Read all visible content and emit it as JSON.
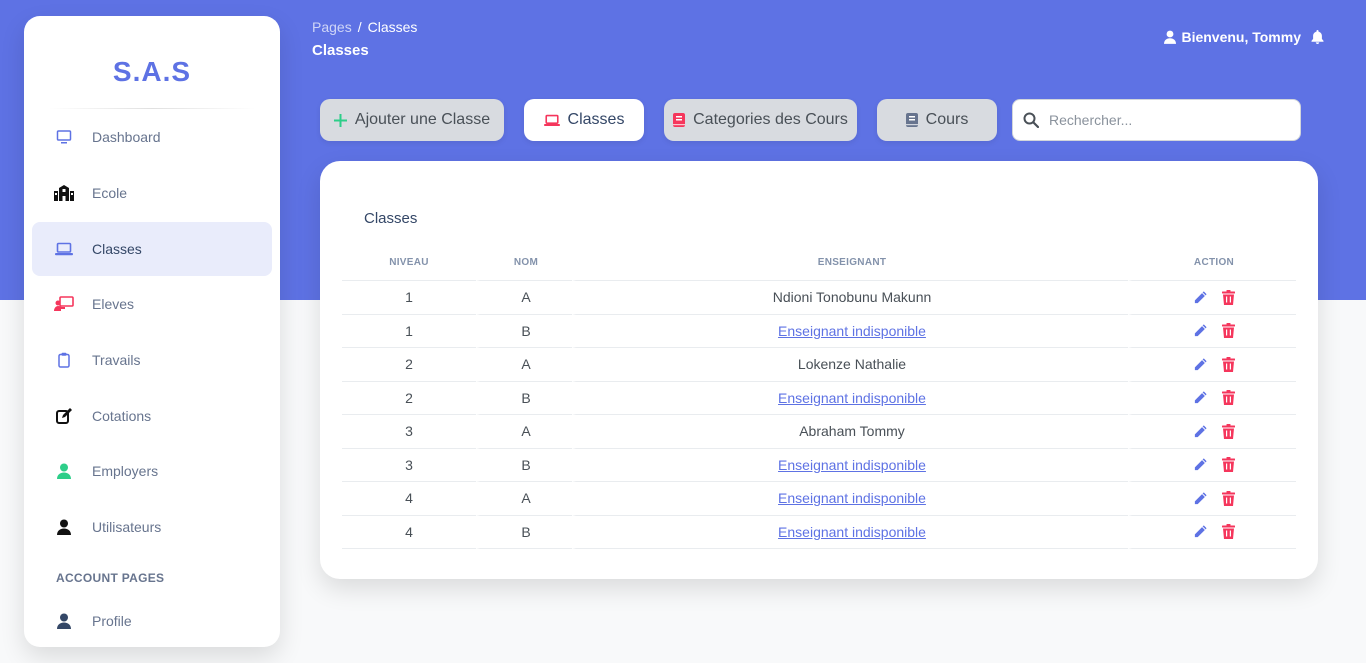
{
  "brand": "S.A.S",
  "sidebar": {
    "items": [
      {
        "label": "Dashboard",
        "icon": "monitor-icon"
      },
      {
        "label": "Ecole",
        "icon": "school-icon"
      },
      {
        "label": "Classes",
        "icon": "laptop-icon",
        "active": true
      },
      {
        "label": "Eleves",
        "icon": "chalkboard-teacher-icon"
      },
      {
        "label": "Travails",
        "icon": "clipboard-icon"
      },
      {
        "label": "Cotations",
        "icon": "edit-icon"
      },
      {
        "label": "Employers",
        "icon": "user-icon"
      },
      {
        "label": "Utilisateurs",
        "icon": "user-icon"
      }
    ],
    "section_title": "ACCOUNT PAGES",
    "account_items": [
      {
        "label": "Profile",
        "icon": "user-icon"
      }
    ]
  },
  "header": {
    "breadcrumb_root": "Pages",
    "breadcrumb_separator": "/",
    "breadcrumb_current": "Classes",
    "title": "Classes",
    "welcome": "Bienvenu, Tommy"
  },
  "toolbar": {
    "add_label": "Ajouter une Classe",
    "classes_label": "Classes",
    "categories_label": "Categories des Cours",
    "cours_label": "Cours",
    "search_placeholder": "Rechercher..."
  },
  "table": {
    "title": "Classes",
    "headers": {
      "niveau": "NIVEAU",
      "nom": "NOM",
      "enseignant": "ENSEIGNANT",
      "action": "ACTION"
    },
    "rows": [
      {
        "niveau": "1",
        "nom": "A",
        "enseignant": "Ndioni Tonobunu Makunn",
        "linked": false
      },
      {
        "niveau": "1",
        "nom": "B",
        "enseignant": "Enseignant indisponible",
        "linked": true
      },
      {
        "niveau": "2",
        "nom": "A",
        "enseignant": "Lokenze Nathalie",
        "linked": false
      },
      {
        "niveau": "2",
        "nom": "B",
        "enseignant": "Enseignant indisponible",
        "linked": true
      },
      {
        "niveau": "3",
        "nom": "A",
        "enseignant": "Abraham Tommy",
        "linked": false
      },
      {
        "niveau": "3",
        "nom": "B",
        "enseignant": "Enseignant indisponible",
        "linked": true
      },
      {
        "niveau": "4",
        "nom": "A",
        "enseignant": "Enseignant indisponible",
        "linked": true
      },
      {
        "niveau": "4",
        "nom": "B",
        "enseignant": "Enseignant indisponible",
        "linked": true
      }
    ]
  },
  "colors": {
    "primary": "#5e72e4",
    "danger": "#f5365c",
    "success": "#2dce89",
    "add_plus": "#2dce89"
  }
}
